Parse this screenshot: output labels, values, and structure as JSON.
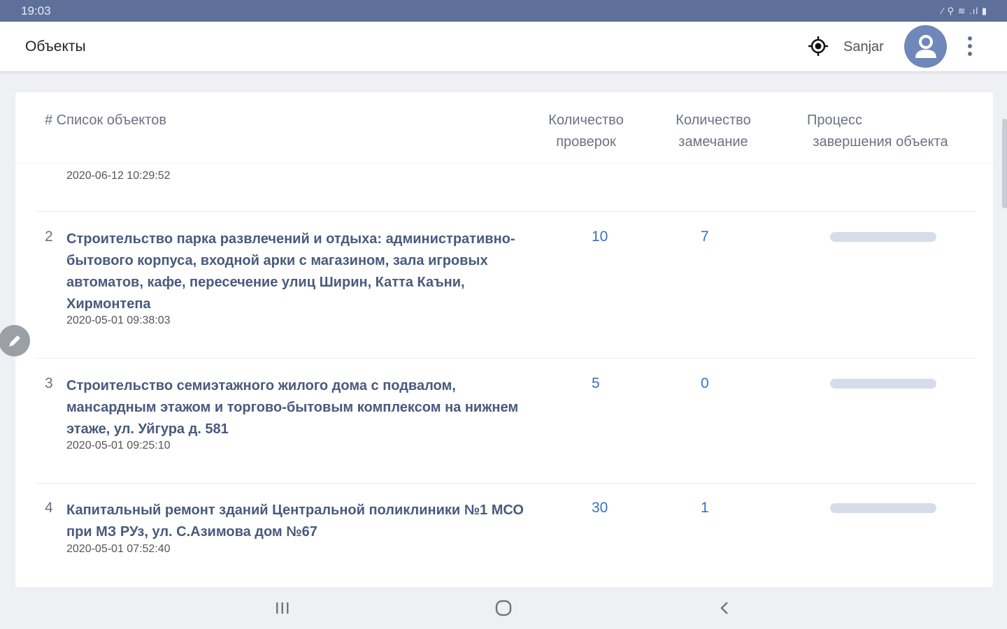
{
  "status_bar": {
    "time": "19:03",
    "icons_text": "⁄ ⚲ ≋ .ıl ▮"
  },
  "app_bar": {
    "title": "Объекты",
    "user_name": "Sanjar"
  },
  "table": {
    "headers": {
      "list": "# Список объектов",
      "checks_line1": "Количество",
      "checks_line2": "проверок",
      "remarks_line1": "Количество",
      "remarks_line2": "замечание",
      "process_line1": "Процесс",
      "process_line2": "завершения объекта"
    },
    "top_partial_date": "2020-06-12 10:29:52",
    "rows": [
      {
        "num": "2",
        "title": "Строительство парка развлечений и отдыха: административно-бытового корпуса, входной арки с магазином, зала игровых автоматов, кафе, пересечение улиц Ширин, Катта Каъни, Хирмонтепа",
        "date": "2020-05-01 09:38:03",
        "checks": "10",
        "remarks": "7",
        "progress": 0
      },
      {
        "num": "3",
        "title": "Строительство семиэтажного жилого дома с подвалом, мансардным этажом и  торгово-бытовым комплексом на нижнем этаже, ул. Уйгура д. 581",
        "date": "2020-05-01 09:25:10",
        "checks": "5",
        "remarks": "0",
        "progress": 0
      },
      {
        "num": "4",
        "title": "Капитальный ремонт зданий Центральной поликлиники №1 МСО при МЗ РУз, ул. С.Азимова дом №67",
        "date": "2020-05-01 07:52:40",
        "checks": "30",
        "remarks": "1",
        "progress": 0
      }
    ]
  },
  "colors": {
    "status_bar": "#5e6f9a",
    "link": "#3a6fc4",
    "title_text": "#4a5a7d",
    "avatar": "#6f87b9",
    "progress_track": "#d6dde9"
  },
  "icons": {
    "target": "target-icon",
    "avatar": "user-avatar-icon",
    "more": "more-vertical-icon",
    "edit": "pencil-icon",
    "recent": "recent-apps-icon",
    "home": "home-icon",
    "back": "back-icon"
  }
}
